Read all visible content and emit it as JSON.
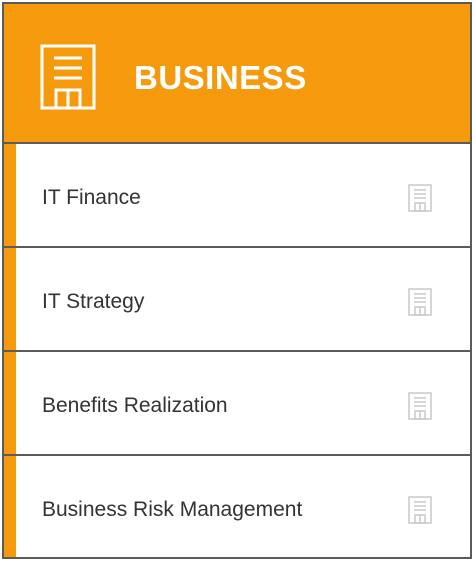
{
  "header": {
    "title": "BUSINESS",
    "icon": "building-icon"
  },
  "items": [
    {
      "label": "IT Finance",
      "icon": "building-icon"
    },
    {
      "label": "IT Strategy",
      "icon": "building-icon"
    },
    {
      "label": "Benefits Realization",
      "icon": "building-icon"
    },
    {
      "label": "Business Risk Management",
      "icon": "building-icon"
    }
  ],
  "colors": {
    "accent": "#f49a0c",
    "border": "#5a5a5a",
    "text": "#333333",
    "icon_muted": "#c8c8c8"
  }
}
